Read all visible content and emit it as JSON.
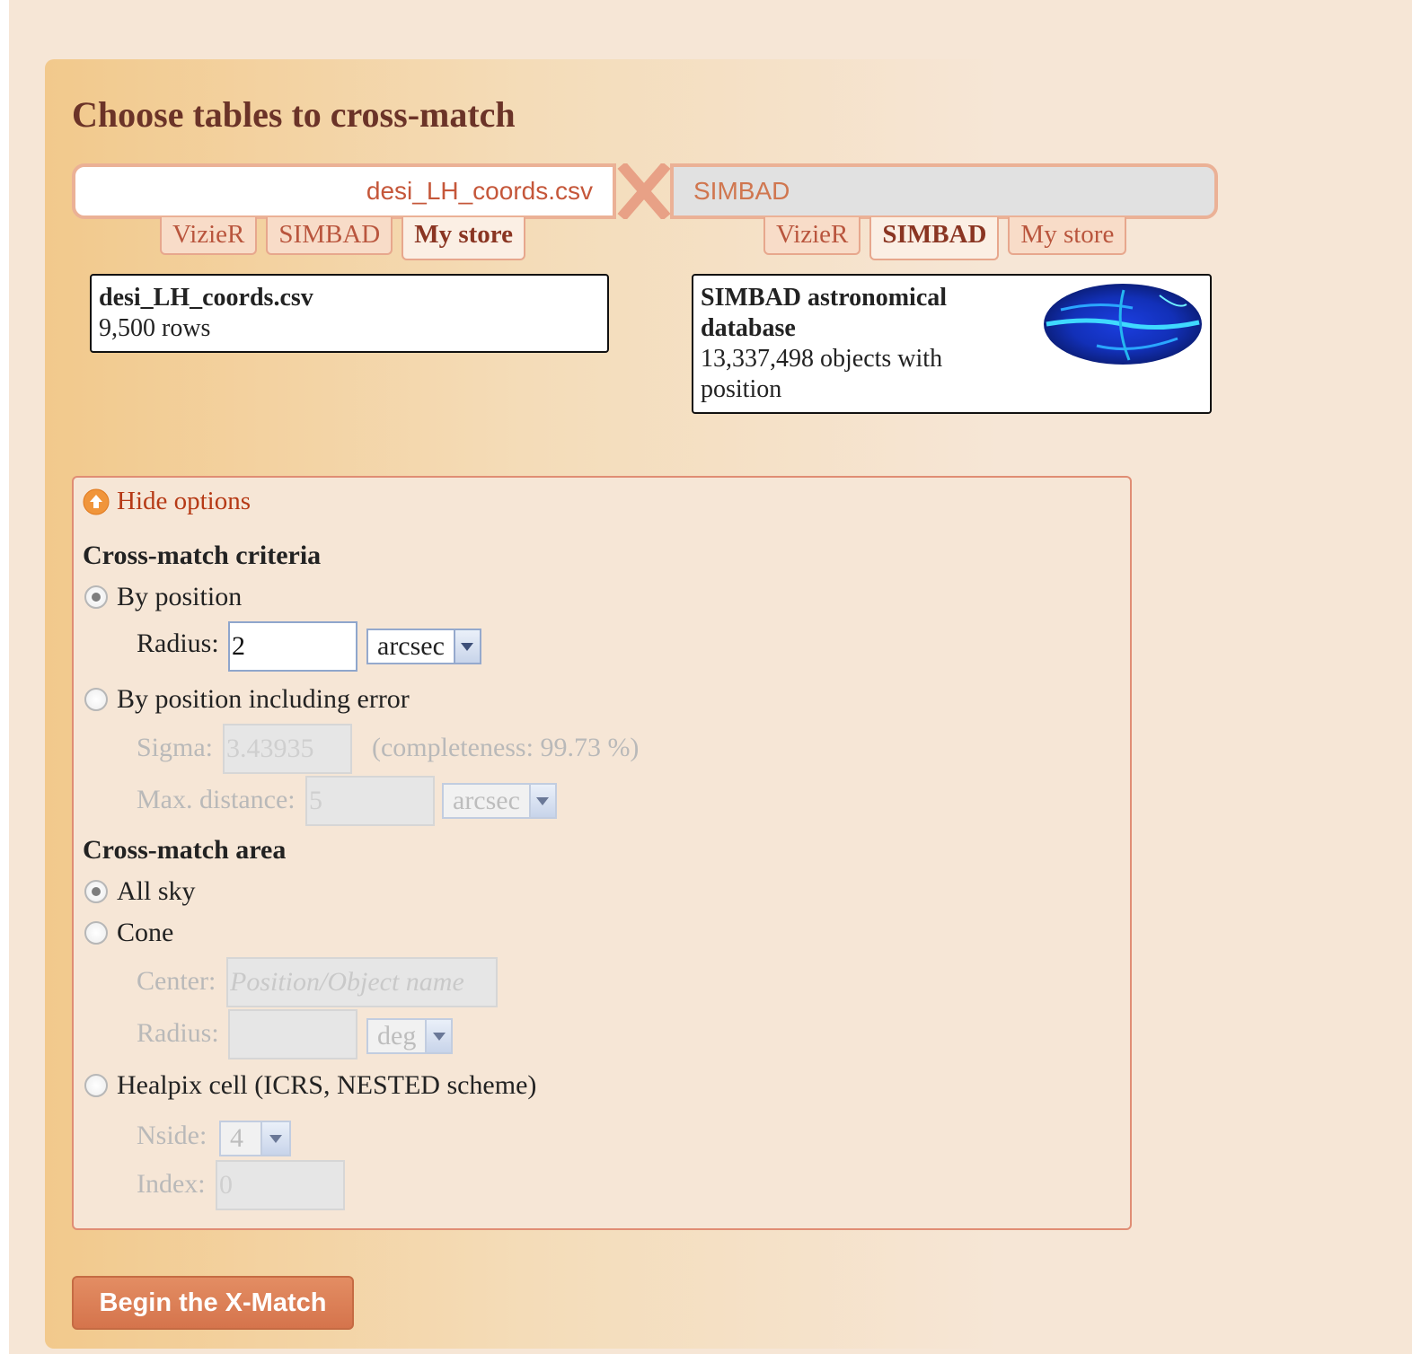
{
  "title": "Choose tables to cross-match",
  "left_table": {
    "name": "desi_LH_coords.csv",
    "tabs": [
      "VizieR",
      "SIMBAD",
      "My store"
    ],
    "active_tab": "My store",
    "info_title": "desi_LH_coords.csv",
    "info_rows": "9,500 rows"
  },
  "right_table": {
    "name": "SIMBAD",
    "tabs": [
      "VizieR",
      "SIMBAD",
      "My store"
    ],
    "active_tab": "SIMBAD",
    "info_title_1": "SIMBAD astronomical",
    "info_title_2": "database",
    "info_count_1": "13,337,498 objects with",
    "info_count_2": "position"
  },
  "options": {
    "toggle_label": "Hide options",
    "criteria_heading": "Cross-match criteria",
    "by_position": {
      "label": "By position",
      "selected": true,
      "radius_label": "Radius:",
      "radius_value": "2",
      "unit": "arcsec"
    },
    "by_position_error": {
      "label": "By position including error",
      "selected": false,
      "sigma_label": "Sigma:",
      "sigma_value": "3.43935",
      "completeness": "(completeness: 99.73 %)",
      "maxdist_label": "Max. distance:",
      "maxdist_value": "5",
      "unit": "arcsec"
    },
    "area_heading": "Cross-match area",
    "all_sky": {
      "label": "All sky",
      "selected": true
    },
    "cone": {
      "label": "Cone",
      "selected": false,
      "center_label": "Center:",
      "center_placeholder": "Position/Object name",
      "radius_label": "Radius:",
      "unit": "deg"
    },
    "healpix": {
      "label": "Healpix cell (ICRS, NESTED scheme)",
      "selected": false,
      "nside_label": "Nside:",
      "nside_value": "4",
      "index_label": "Index:",
      "index_value": "0"
    }
  },
  "begin_button": "Begin the X-Match",
  "colors": {
    "accent": "#d5744c",
    "title": "#6b3328",
    "tab_text": "#b9553d",
    "link": "#b63a16"
  }
}
